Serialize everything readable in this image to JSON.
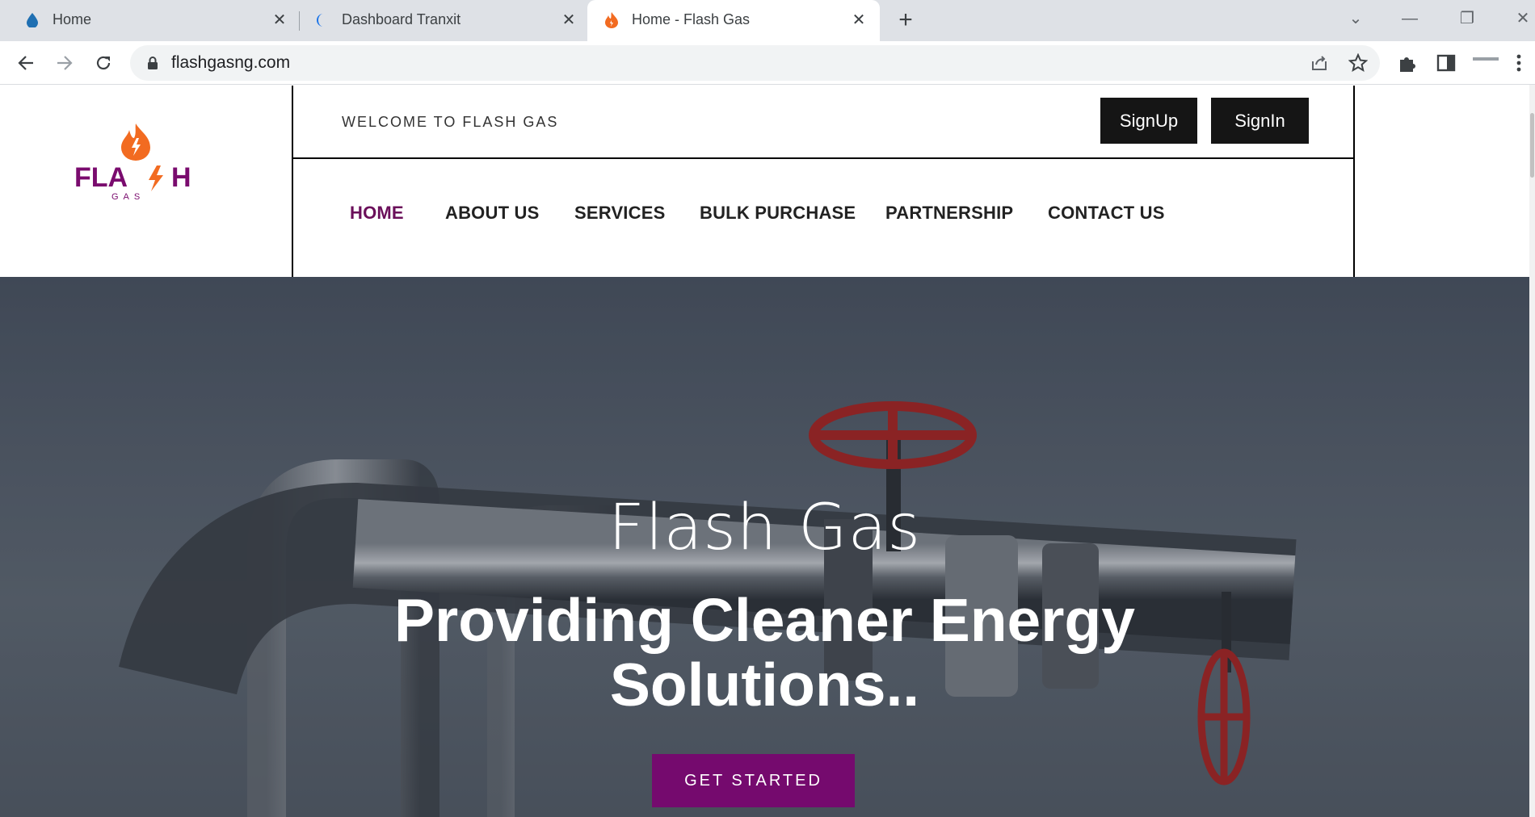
{
  "browser": {
    "tabs": [
      {
        "title": "Home",
        "icon": "water-drop-icon"
      },
      {
        "title": "Dashboard Tranxit",
        "icon": "crescent-icon"
      },
      {
        "title": "Home - Flash Gas",
        "icon": "flame-icon",
        "active": true
      }
    ],
    "url": "flashgasng.com"
  },
  "header": {
    "welcome": "WELCOME TO FLASH GAS",
    "signup": "SignUp",
    "signin": "SignIn",
    "logo": {
      "word": "FLA H",
      "sub": "G A S"
    }
  },
  "nav": {
    "items": [
      "HOME",
      "ABOUT US",
      "SERVICES",
      "BULK PURCHASE",
      "PARTNERSHIP",
      "CONTACT US"
    ],
    "active": "HOME"
  },
  "hero": {
    "brand": "Flash Gas",
    "tagline_line1": "Providing Cleaner Energy",
    "tagline_line2": "Solutions..",
    "cta": "GET STARTED"
  },
  "colors": {
    "accent": "#750a6e",
    "nav_active": "#6b0f5a",
    "button_dark": "#151515",
    "flame": "#f26b21"
  }
}
